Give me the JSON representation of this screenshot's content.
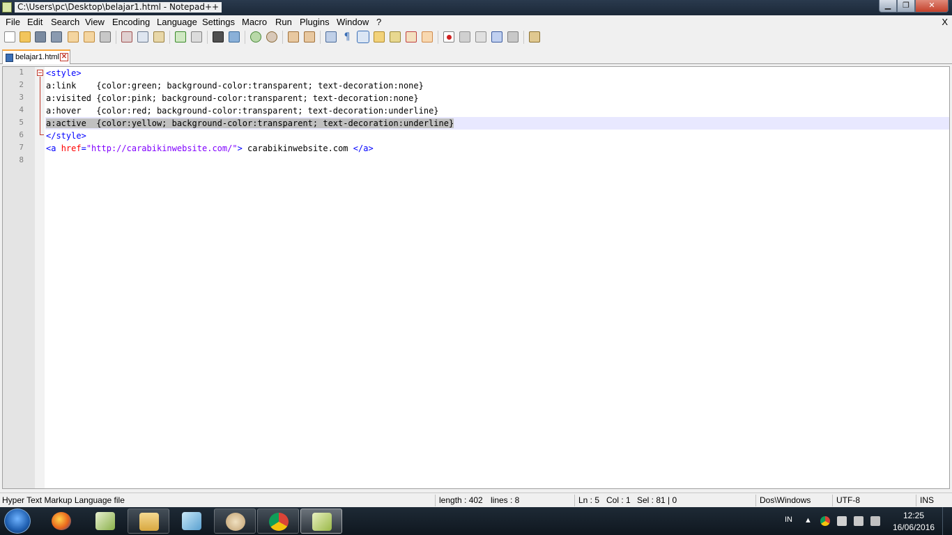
{
  "window": {
    "title": "C:\\Users\\pc\\Desktop\\belajar1.html - Notepad++",
    "minimize_label": "▁",
    "maximize_label": "❐",
    "close_label": "✕"
  },
  "menu": {
    "items": [
      "File",
      "Edit",
      "Search",
      "View",
      "Encoding",
      "Language",
      "Settings",
      "Macro",
      "Run",
      "Plugins",
      "Window",
      "?"
    ],
    "close_label": "X"
  },
  "toolbar": {
    "icons": [
      "new-file-icon",
      "open-file-icon",
      "save-icon",
      "save-all-icon",
      "close-icon",
      "close-all-icon",
      "print-icon",
      "cut-icon",
      "copy-icon",
      "paste-icon",
      "undo-icon",
      "redo-icon",
      "find-icon",
      "replace-icon",
      "zoom-in-icon",
      "zoom-out-icon",
      "sync-vertical-icon",
      "sync-horizontal-icon",
      "word-wrap-icon",
      "show-all-chars-icon",
      "indent-guide-icon",
      "user-defined-lang-icon",
      "doc-map-icon",
      "function-list-icon",
      "folder-as-workspace-icon",
      "record-macro-icon",
      "stop-record-icon",
      "play-macro-icon",
      "run-macro-multiple-icon",
      "save-macro-icon",
      "launch-browser-icon"
    ]
  },
  "tab": {
    "label": "belajar1.html",
    "close_label": "✕"
  },
  "editor": {
    "line_numbers": [
      "1",
      "2",
      "3",
      "4",
      "5",
      "6",
      "7",
      "8"
    ],
    "current_line": 5,
    "lines": {
      "l1_tag": "<style>",
      "l2": "a:link    {color:green; background-color:transparent; text-decoration:none}",
      "l3": "a:visited {color:pink; background-color:transparent; text-decoration:none}",
      "l4": "a:hover   {color:red; background-color:transparent; text-decoration:underline}",
      "l5": "a:active  {color:yellow; background-color:transparent; text-decoration:underline}",
      "l6_tag": "</style>",
      "l7_open": "<a ",
      "l7_attr": "href",
      "l7_eq": "=",
      "l7_val": "\"http://carabikinwebsite.com/\"",
      "l7_close": ">",
      "l7_text": " carabikinwebsite.com ",
      "l7_end": "</a>"
    }
  },
  "status": {
    "file_type": "Hyper Text Markup Language file",
    "length": "length : 402",
    "lines": "lines : 8",
    "ln": "Ln : 5",
    "col": "Col : 1",
    "sel": "Sel : 81 | 0",
    "eol": "Dos\\Windows",
    "encoding": "UTF-8",
    "mode": "INS"
  },
  "taskbar": {
    "language": "IN",
    "time": "12:25",
    "date": "16/06/2016"
  },
  "colors": {
    "tag": "#0000ff",
    "attr": "#ff0000",
    "string": "#8000ff",
    "current_line": "#e8e8ff",
    "selection": "#c0c0c0"
  }
}
